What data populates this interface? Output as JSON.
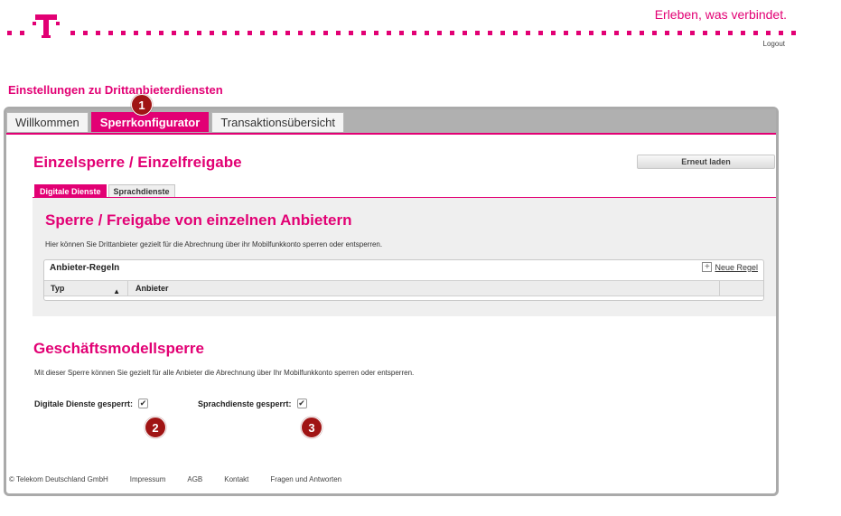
{
  "header": {
    "slogan": "Erleben, was verbindet.",
    "logout": "Logout"
  },
  "page_title": "Einstellungen zu Drittanbieterdiensten",
  "main_tabs": [
    {
      "label": "Willkommen"
    },
    {
      "label": "Sperrkonfigurator",
      "active": true
    },
    {
      "label": "Transaktionsübersicht"
    }
  ],
  "section": {
    "title": "Einzelsperre / Einzelfreigabe",
    "reload_label": "Erneut laden"
  },
  "sub_tabs": [
    {
      "label": "Digitale Dienste",
      "active": true
    },
    {
      "label": "Sprachdienste"
    }
  ],
  "panel": {
    "title": "Sperre / Freigabe von einzelnen Anbietern",
    "description": "Hier können Sie Drittanbieter gezielt für die Abrechnung über ihr Mobilfunkkonto sperren oder entsperren.",
    "rules_title": "Anbieter-Regeln",
    "new_rule_label": "Neue Regel",
    "plus_glyph": "+",
    "columns": [
      "Typ",
      "Anbieter"
    ],
    "sort_glyph": "▲"
  },
  "business_model": {
    "title": "Geschäftsmodellsperre",
    "description": "Mit dieser Sperre können Sie gezielt für alle Anbieter die Abrechnung über Ihr Mobilfunkkonto sperren oder entsperren.",
    "checkboxes": [
      {
        "label": "Digitale Dienste gesperrt:",
        "checked": true,
        "glyph": "✔"
      },
      {
        "label": "Sprachdienste gesperrt:",
        "checked": true,
        "glyph": "✔"
      }
    ]
  },
  "markers": [
    "1",
    "2",
    "3"
  ],
  "footer": {
    "copyright": "© Telekom Deutschland GmbH",
    "links": [
      "Impressum",
      "AGB",
      "Kontakt",
      "Fragen und Antworten"
    ]
  },
  "colors": {
    "brand": "#e20074",
    "marker": "#a01414"
  }
}
